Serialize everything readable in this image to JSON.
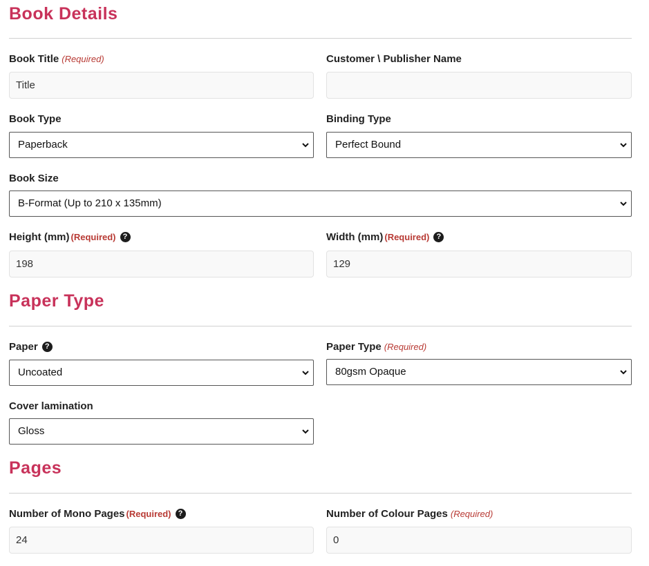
{
  "book_details": {
    "title": "Book Details",
    "book_title_label": "Book Title",
    "book_title_required": "(Required)",
    "book_title_value": "Title",
    "customer_label": "Customer \\ Publisher Name",
    "customer_value": "",
    "book_type_label": "Book Type",
    "book_type_value": "Paperback",
    "binding_type_label": "Binding Type",
    "binding_type_value": "Perfect Bound",
    "book_size_label": "Book Size",
    "book_size_value": "B-Format (Up to 210 x 135mm)",
    "height_label": "Height (mm)",
    "height_required": "(Required)",
    "height_value": "198",
    "width_label": "Width (mm)",
    "width_required": "(Required)",
    "width_value": "129"
  },
  "paper_type": {
    "title": "Paper Type",
    "paper_label": "Paper",
    "paper_value": "Uncoated",
    "paper_type_label": "Paper Type",
    "paper_type_required": "(Required)",
    "paper_type_value": "80gsm Opaque",
    "cover_lamination_label": "Cover lamination",
    "cover_lamination_value": "Gloss"
  },
  "pages": {
    "title": "Pages",
    "mono_label": "Number of Mono Pages",
    "mono_required": "(Required)",
    "mono_value": "24",
    "colour_label": "Number of Colour Pages",
    "colour_required": "(Required)",
    "colour_value": "0"
  },
  "help_glyph": "?",
  "colors": {
    "heading": "#c8325a",
    "required": "#b83a34"
  }
}
